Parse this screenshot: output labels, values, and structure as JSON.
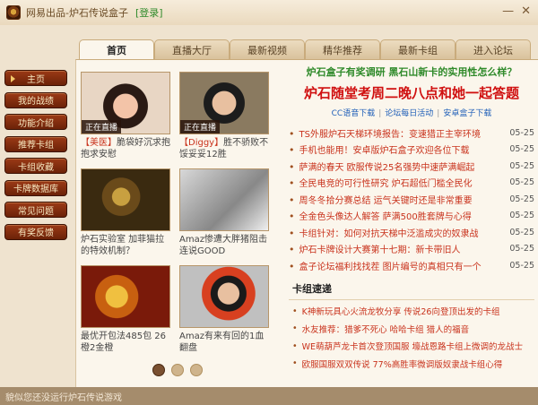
{
  "window": {
    "title": "网易出品-炉石传说盒子",
    "login_label": "[登录]",
    "minimize": "—",
    "close": "✕"
  },
  "tabs": [
    {
      "label": "首页",
      "active": true
    },
    {
      "label": "直播大厅"
    },
    {
      "label": "最新视频"
    },
    {
      "label": "精华推荐"
    },
    {
      "label": "最新卡组"
    },
    {
      "label": "进入论坛"
    }
  ],
  "sidebar": {
    "items": [
      {
        "label": "主页",
        "active": true
      },
      {
        "label": "我的战绩"
      },
      {
        "label": "功能介绍"
      },
      {
        "label": "推荐卡组"
      },
      {
        "label": "卡组收藏"
      },
      {
        "label": "卡牌数据库"
      },
      {
        "label": "常见问题"
      },
      {
        "label": "有奖反馈"
      }
    ]
  },
  "videos": [
    {
      "badge": "正在直播",
      "tag": "【美医】",
      "title": "脆袋好沉求抱抱求安慰"
    },
    {
      "badge": "正在直播",
      "tag": "【Diggy】",
      "title": "胜不骄败不馁妥妥12胜"
    },
    {
      "badge": "",
      "tag": "",
      "title": "炉石实验室 加菲猫拉的特效机制？"
    },
    {
      "badge": "",
      "tag": "",
      "title": "Amaz惨遭大胖猪阻击 连说GOOD"
    },
    {
      "badge": "",
      "tag": "",
      "title": "最优开包法485包 26橙2金橙"
    },
    {
      "badge": "",
      "tag": "",
      "title": "Amaz有来有回的1血翻盘"
    }
  ],
  "carousel": {
    "count": 3,
    "active": 0
  },
  "headline": {
    "sub": "炉石盒子有奖调研 黑石山新卡的实用性怎么样？",
    "main": "炉石随堂考周二晚八点和她一起答题",
    "links": [
      "CC语音下载",
      "论坛每日活动",
      "安卓盒子下载"
    ]
  },
  "news": [
    {
      "title": "TS外服炉石天梯环境报告：变速猎正主宰环境",
      "date": "05-25"
    },
    {
      "title": "手机也能用！安卓版炉石盒子欢迎各位下载",
      "date": "05-25"
    },
    {
      "title": "萨满的春天 欧服传说25名强势中速萨满崛起",
      "date": "05-25"
    },
    {
      "title": "全民电竞的可行性研究 炉石超低门槛全民化",
      "date": "05-25"
    },
    {
      "title": "周冬冬拾分赛总结 运气关键时还是非常重要",
      "date": "05-25"
    },
    {
      "title": "全金色头像达人解答 萨满500胜套牌与心得",
      "date": "05-25"
    },
    {
      "title": "卡组针对：如何对抗天梯中泛滥成灾的奴隶战",
      "date": "05-25"
    },
    {
      "title": "炉石卡牌设计大赛第十七期：新卡带旧人",
      "date": "05-25"
    },
    {
      "title": "盒子论坛福利找找茬 图片编号的真相只有一个",
      "date": "05-25"
    }
  ],
  "decks": {
    "title": "卡组速递",
    "items": [
      "K神新玩具心火流龙牧分享 传说26向登顶出发的卡组",
      "水友推荐：猎爹不死心 哈哈卡组 猎人的福音",
      "WE萌葫芦龙卡首次登顶国服 壕战恩路卡组上微调的龙战士",
      "欧服国服双双传说 77%高胜率微调版奴隶战卡组心得"
    ]
  },
  "status": {
    "text": "貌似您还没运行炉石传说游戏"
  }
}
